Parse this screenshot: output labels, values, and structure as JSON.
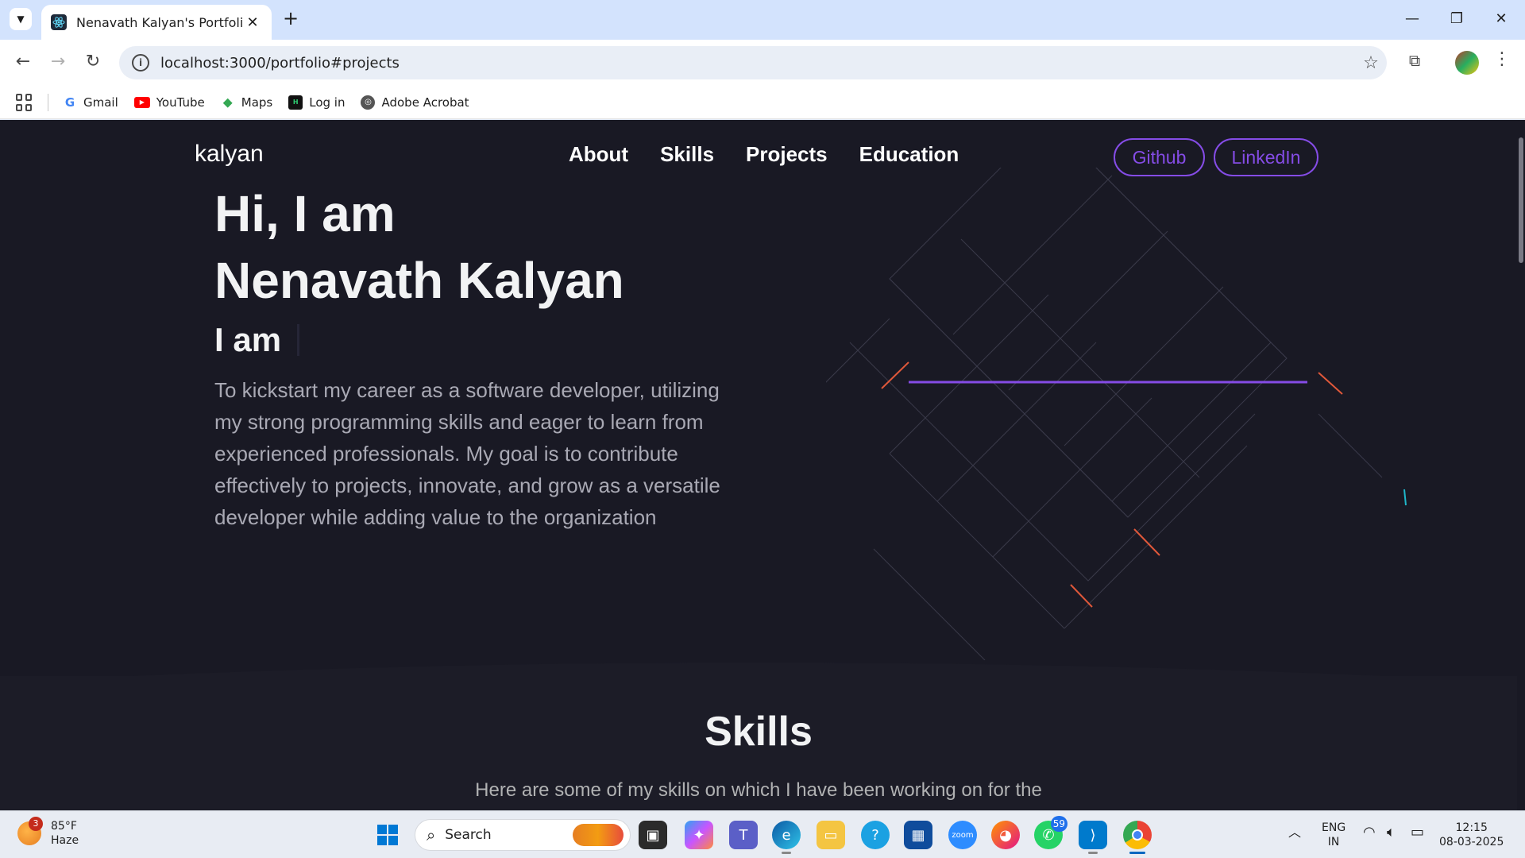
{
  "browser": {
    "tab_title": "Nenavath Kalyan's Portfolio",
    "url": "localhost:3000/portfolio#projects",
    "bookmarks": [
      {
        "label": "Gmail",
        "icon": "gmail-icon"
      },
      {
        "label": "YouTube",
        "icon": "youtube-icon"
      },
      {
        "label": "Maps",
        "icon": "maps-icon"
      },
      {
        "label": "Log in",
        "icon": "login-icon"
      },
      {
        "label": "Adobe Acrobat",
        "icon": "acrobat-icon"
      }
    ]
  },
  "page": {
    "logo": "kalyan",
    "nav": [
      "About",
      "Skills",
      "Projects",
      "Education"
    ],
    "github_label": "Github",
    "linkedin_label": "LinkedIn",
    "hero_line1": "Hi, I am",
    "hero_line2": "Nenavath Kalyan",
    "hero_sub": "I am",
    "hero_desc": "To kickstart my career as a software developer, utilizing my strong programming skills and eager to learn from experienced professionals. My goal is to contribute effectively to projects, innovate, and grow as a versatile developer while adding value to the organization",
    "skills_title": "Skills",
    "skills_desc": "Here are some of my skills on which I have been working on for the",
    "accent_color": "#854ce6",
    "background_color": "#191924"
  },
  "taskbar": {
    "weather_badge": "3",
    "temperature": "85°F",
    "condition": "Haze",
    "search_placeholder": "Search",
    "whatsapp_badge": "59",
    "lang_line1": "ENG",
    "lang_line2": "IN",
    "time": "12:15",
    "date": "08-03-2025"
  }
}
